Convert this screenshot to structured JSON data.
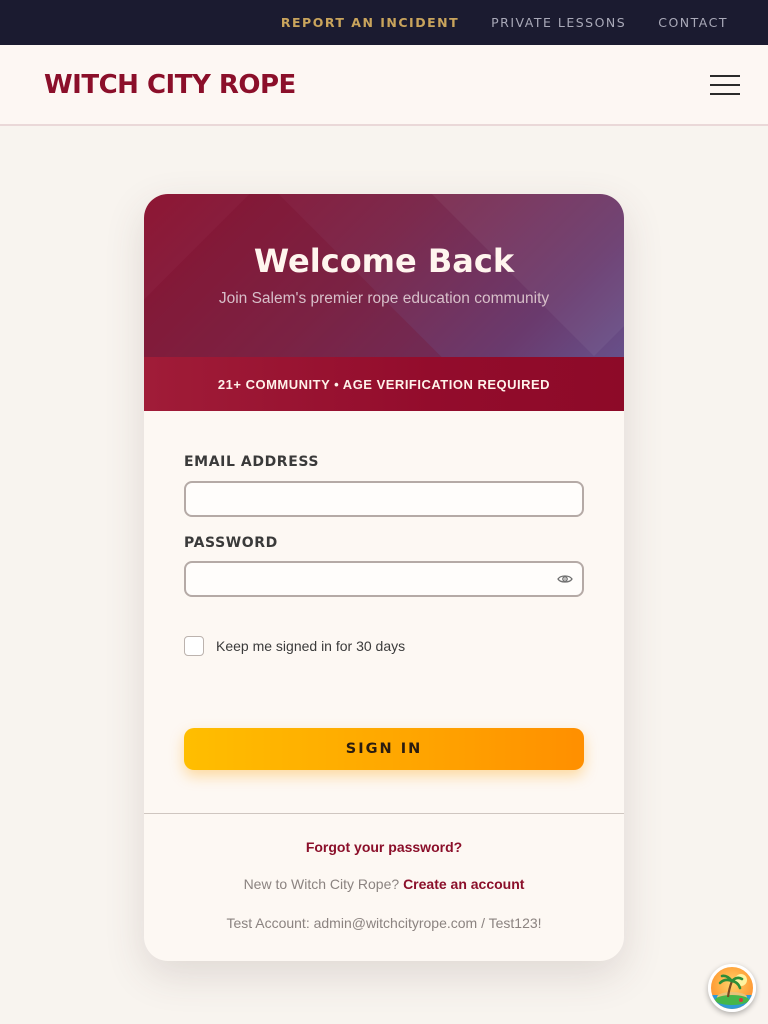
{
  "utility_nav": {
    "report_incident": "REPORT AN INCIDENT",
    "private_lessons": "PRIVATE LESSONS",
    "contact": "CONTACT"
  },
  "header": {
    "logo": "WITCH CITY ROPE",
    "menu_icon": "hamburger-menu-icon"
  },
  "login_card": {
    "title": "Welcome Back",
    "subtitle": "Join Salem's premier rope education community",
    "age_notice": "21+ COMMUNITY • AGE VERIFICATION REQUIRED",
    "email_label": "EMAIL ADDRESS",
    "email_value": "",
    "password_label": "PASSWORD",
    "password_value": "",
    "password_toggle_icon": "eye-icon",
    "remember_label": "Keep me signed in for 30 days",
    "remember_checked": false,
    "sign_in_label": "SIGN IN",
    "forgot_password": "Forgot your password?",
    "new_user_text": "New to Witch City Rope?",
    "create_account": "Create an account",
    "test_account": "Test Account: admin@witchcityrope.com / Test123!"
  },
  "floating_button": {
    "icon": "tropical-island-icon"
  },
  "colors": {
    "utility_bar_bg": "#1b1b30",
    "incident_link": "#c9a45c",
    "brand_burgundy": "#8b0f2a",
    "page_bg": "#f8f4ef",
    "signin_gradient_start": "#ffbe00",
    "signin_gradient_end": "#ff8f00"
  }
}
